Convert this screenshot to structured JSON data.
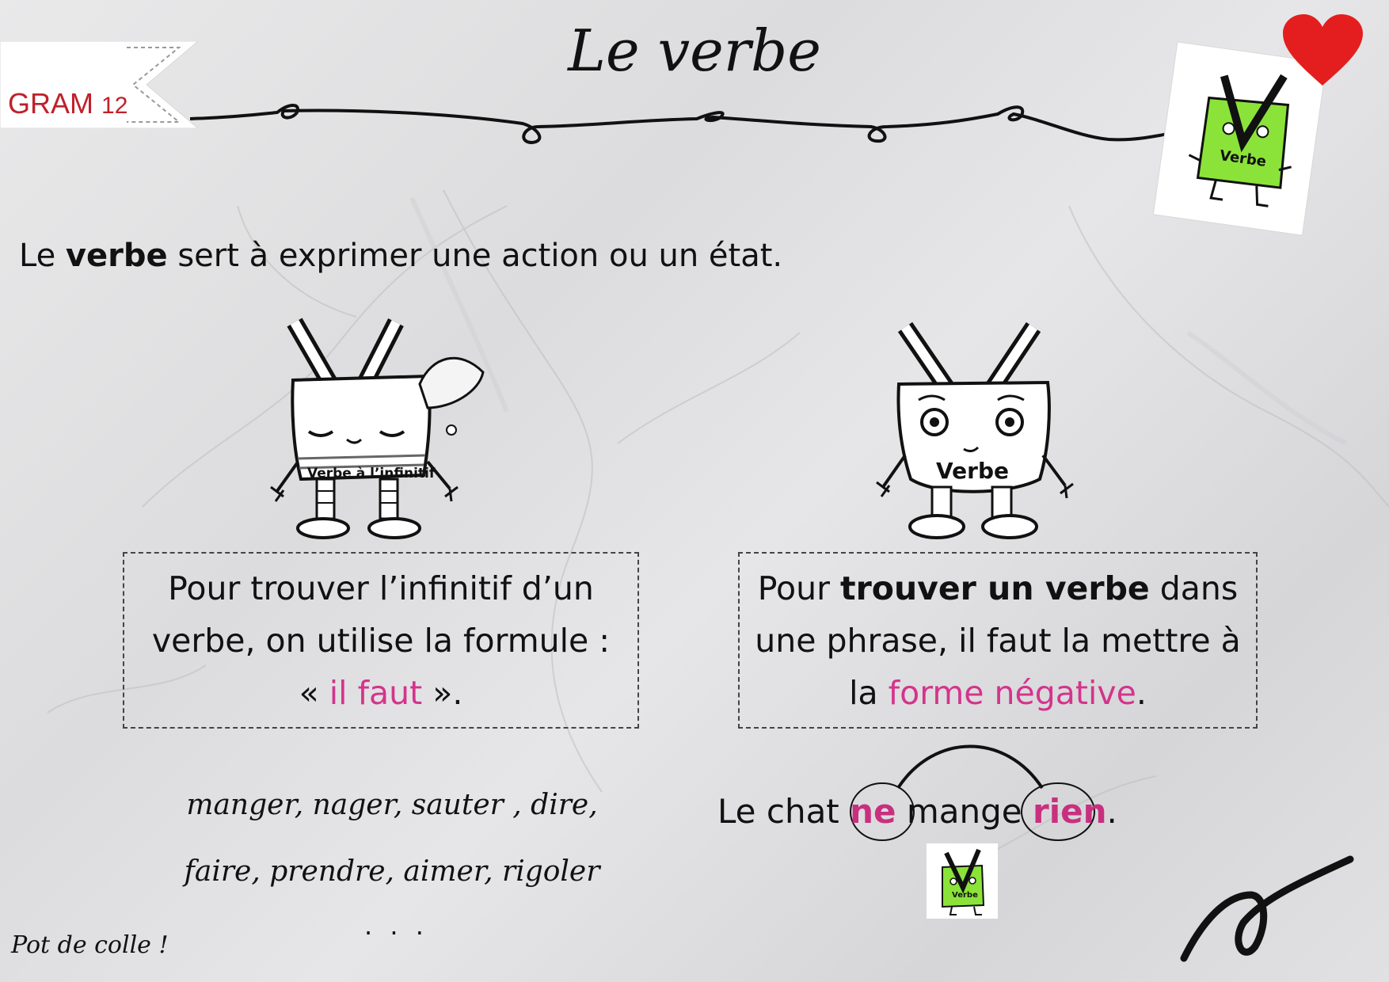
{
  "header": {
    "code_label": "GRAM",
    "code_number": "12",
    "title": "Le verbe"
  },
  "definition": {
    "prefix": "Le ",
    "keyword": "verbe",
    "suffix": " sert à exprimer une action ou un état."
  },
  "left_card": {
    "mascot_label": "Verbe à l’infinitif",
    "rule_part1": "Pour trouver l’infinitif d’un verbe, on utilise la formule :",
    "rule_quote_open": "« ",
    "rule_highlight": "il faut",
    "rule_quote_close": " ».",
    "examples_line1": "manger, nager, sauter , dire,",
    "examples_line2": "faire, prendre, aimer, rigoler",
    "examples_more": ". . ."
  },
  "right_card": {
    "mascot_label": "Verbe",
    "rule_part1": "Pour ",
    "rule_bold": "trouver un verbe",
    "rule_part2": " dans une phrase, il faut la mettre à la ",
    "rule_highlight": "forme négative",
    "rule_end": ".",
    "example_start": "Le chat ",
    "example_neg1": "ne",
    "example_verb": " mange ",
    "example_neg2": "rien",
    "example_end": ".",
    "small_badge_label": "Verbe"
  },
  "corner_badge_label": "Verbe",
  "footer": {
    "text": "Pot de colle !"
  },
  "colors": {
    "accent_pink": "#d4348c",
    "banner_red": "#c0202a",
    "heart_red": "#e41e1e",
    "mascot_green": "#8be33a"
  },
  "icons": [
    "heart-icon",
    "verb-mascot-sleeping",
    "verb-mascot-awake",
    "verb-badge-green"
  ]
}
